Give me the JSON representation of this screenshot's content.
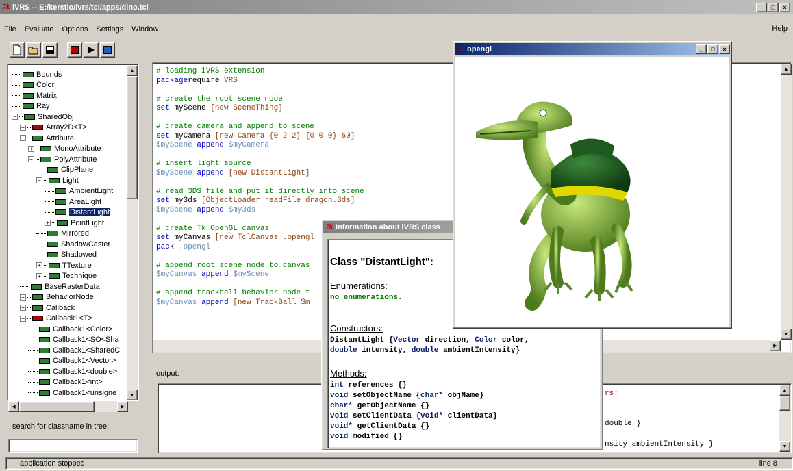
{
  "window": {
    "title": "iVRS -- E:/kerstio/ivrs/tcl/apps/dino.tcl",
    "icon": "tk-icon"
  },
  "menu": [
    {
      "label": "File"
    },
    {
      "label": "Evaluate"
    },
    {
      "label": "Options"
    },
    {
      "label": "Settings"
    },
    {
      "label": "Window"
    }
  ],
  "help_label": "Help",
  "toolbar": [
    "new-file-icon",
    "open-folder-icon",
    "save-icon",
    "stop-icon",
    "play-icon",
    "step-icon"
  ],
  "tree": [
    {
      "label": "Bounds",
      "indent": 0,
      "exp": "",
      "color": "green"
    },
    {
      "label": "Color",
      "indent": 0,
      "exp": "",
      "color": "green"
    },
    {
      "label": "Matrix",
      "indent": 0,
      "exp": "",
      "color": "green"
    },
    {
      "label": "Ray",
      "indent": 0,
      "exp": "",
      "color": "green"
    },
    {
      "label": "SharedObj",
      "indent": 0,
      "exp": "-",
      "color": "green"
    },
    {
      "label": "Array2D<T>",
      "indent": 1,
      "exp": "+",
      "color": "red"
    },
    {
      "label": "Attribute",
      "indent": 1,
      "exp": "-",
      "color": "green"
    },
    {
      "label": "MonoAttribute",
      "indent": 2,
      "exp": "+",
      "color": "green"
    },
    {
      "label": "PolyAttribute",
      "indent": 2,
      "exp": "-",
      "color": "green"
    },
    {
      "label": "ClipPlane",
      "indent": 3,
      "exp": "",
      "color": "green"
    },
    {
      "label": "Light",
      "indent": 3,
      "exp": "-",
      "color": "green"
    },
    {
      "label": "AmbientLight",
      "indent": 4,
      "exp": "",
      "color": "green"
    },
    {
      "label": "AreaLight",
      "indent": 4,
      "exp": "",
      "color": "green"
    },
    {
      "label": "DistantLight",
      "indent": 4,
      "exp": "",
      "color": "green",
      "selected": true
    },
    {
      "label": "PointLight",
      "indent": 4,
      "exp": "+",
      "color": "green"
    },
    {
      "label": "Mirrored",
      "indent": 3,
      "exp": "",
      "color": "green"
    },
    {
      "label": "ShadowCaster",
      "indent": 3,
      "exp": "",
      "color": "green"
    },
    {
      "label": "Shadowed",
      "indent": 3,
      "exp": "",
      "color": "green"
    },
    {
      "label": "TTexture",
      "indent": 3,
      "exp": "+",
      "color": "green"
    },
    {
      "label": "Technique",
      "indent": 3,
      "exp": "+",
      "color": "green"
    },
    {
      "label": "BaseRasterData",
      "indent": 1,
      "exp": "",
      "color": "green"
    },
    {
      "label": "BehaviorNode",
      "indent": 1,
      "exp": "+",
      "color": "green"
    },
    {
      "label": "Callback",
      "indent": 1,
      "exp": "+",
      "color": "green"
    },
    {
      "label": "Callback1<T>",
      "indent": 1,
      "exp": "-",
      "color": "red"
    },
    {
      "label": "Callback1<Color>",
      "indent": 2,
      "exp": "",
      "color": "green"
    },
    {
      "label": "Callback1<SO<Sha",
      "indent": 2,
      "exp": "",
      "color": "green"
    },
    {
      "label": "Callback1<SharedC",
      "indent": 2,
      "exp": "",
      "color": "green"
    },
    {
      "label": "Callback1<Vector>",
      "indent": 2,
      "exp": "",
      "color": "green"
    },
    {
      "label": "Callback1<double>",
      "indent": 2,
      "exp": "",
      "color": "green"
    },
    {
      "label": "Callback1<int>",
      "indent": 2,
      "exp": "",
      "color": "green"
    },
    {
      "label": "Callback1<unsigne",
      "indent": 2,
      "exp": "",
      "color": "green"
    }
  ],
  "search": {
    "label": "search for classname in tree:",
    "value": ""
  },
  "script": [
    [
      [
        "cm",
        "# loading iVRS extension"
      ]
    ],
    [
      [
        "kw",
        "package"
      ],
      [
        "",
        "require "
      ],
      [
        "st",
        "VRS"
      ]
    ],
    [],
    [
      [
        "cm",
        "# create the root scene node"
      ]
    ],
    [
      [
        "kw",
        "set"
      ],
      [
        "",
        " myScene "
      ],
      [
        "st",
        "[new SceneThing]"
      ]
    ],
    [],
    [
      [
        "cm",
        "# create camera and append to scene"
      ]
    ],
    [
      [
        "kw",
        "set"
      ],
      [
        "",
        " myCamera "
      ],
      [
        "st",
        "[new Camera {0 2 2} {0 0 0} 60]"
      ]
    ],
    [
      [
        "vr",
        "$myScene"
      ],
      [
        "kw",
        " append "
      ],
      [
        "vr",
        "$myCamera"
      ]
    ],
    [],
    [
      [
        "cm",
        "# insert light source"
      ]
    ],
    [
      [
        "vr",
        "$myScene"
      ],
      [
        "kw",
        " append "
      ],
      [
        "st",
        "[new DistantLight]"
      ]
    ],
    [],
    [
      [
        "cm",
        "# read 3DS file and put it directly into scene"
      ]
    ],
    [
      [
        "kw",
        "set"
      ],
      [
        "",
        " my3ds "
      ],
      [
        "st",
        "[ObjectLoader readFile dragon.3ds]"
      ]
    ],
    [
      [
        "vr",
        "$myScene"
      ],
      [
        "kw",
        " append "
      ],
      [
        "vr",
        "$my3ds"
      ]
    ],
    [],
    [
      [
        "cm",
        "# create Tk OpenGL canvas"
      ]
    ],
    [
      [
        "kw",
        "set"
      ],
      [
        "",
        " myCanvas "
      ],
      [
        "st",
        "[new TclCanvas .opengl"
      ]
    ],
    [
      [
        "kw",
        "pack"
      ],
      [
        "vr",
        " .opengl"
      ]
    ],
    [],
    [
      [
        "cm",
        "# append root scene node to canvas"
      ]
    ],
    [
      [
        "vr",
        "$myCanvas"
      ],
      [
        "kw",
        " append "
      ],
      [
        "vr",
        "$myScene"
      ]
    ],
    [],
    [
      [
        "cm",
        "# append trackball behavior node t"
      ]
    ],
    [
      [
        "vr",
        "$myCanvas"
      ],
      [
        "kw",
        " append "
      ],
      [
        "st",
        "[new TrackBall $m"
      ]
    ]
  ],
  "output_label": "output:",
  "output_fragments": [
    "rs:",
    "double }",
    "nsity ambientIntensity }"
  ],
  "status": {
    "left": "application stopped",
    "right": "line 8"
  },
  "info": {
    "title": "Information about iVRS class",
    "heading": "Class \"DistantLight\":",
    "enum_label": "Enumerations:",
    "enum_value": "no enumerations.",
    "ctor_label": "Constructors:",
    "ctor": [
      [
        [
          "b",
          "DistantLight {"
        ],
        [
          "t",
          "Vector"
        ],
        [
          "b",
          " direction, "
        ],
        [
          "t",
          "Color"
        ],
        [
          "b",
          " color,"
        ]
      ],
      [
        [
          "t",
          "double"
        ],
        [
          "b",
          " intensity, "
        ],
        [
          "t",
          "double"
        ],
        [
          "b",
          " ambientIntensity}"
        ]
      ]
    ],
    "methods_label": "Methods:",
    "methods": [
      [
        [
          "t",
          "int"
        ],
        [
          "b",
          " references {}"
        ]
      ],
      [
        [
          "t",
          "void"
        ],
        [
          "b",
          " setObjectName {"
        ],
        [
          "t",
          "char*"
        ],
        [
          "b",
          " objName}"
        ]
      ],
      [
        [
          "t",
          "char*"
        ],
        [
          "b",
          " getObjectName {}"
        ]
      ],
      [
        [
          "t",
          "void"
        ],
        [
          "b",
          " setClientData {"
        ],
        [
          "t",
          "void*"
        ],
        [
          "b",
          " clientData}"
        ]
      ],
      [
        [
          "t",
          "void*"
        ],
        [
          "b",
          " getClientData {}"
        ]
      ],
      [
        [
          "t",
          "void"
        ],
        [
          "b",
          " modified {}"
        ]
      ]
    ]
  },
  "opengl": {
    "title": "opengl"
  },
  "colors": {
    "keyword": "#0000c0",
    "comment": "#008000",
    "string": "#8b4513",
    "variable": "#6a8fb5",
    "selection": "#0a246a"
  }
}
